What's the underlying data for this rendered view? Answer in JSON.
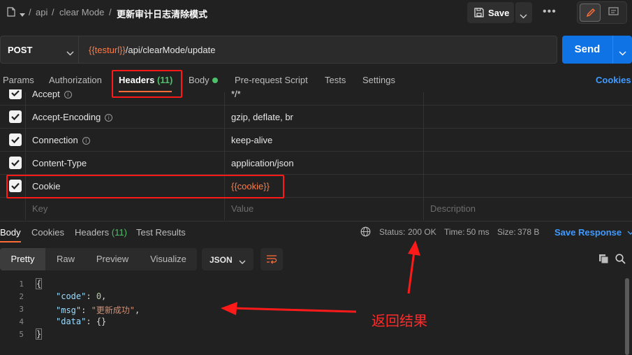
{
  "breadcrumb": {
    "parts": [
      "api",
      "clear Mode"
    ],
    "title": "更新审计日志清除模式",
    "separator": "/"
  },
  "toolbar": {
    "save_label": "Save",
    "more_label": "•••"
  },
  "request": {
    "method": "POST",
    "url_var": "{{testurl}}",
    "url_path": "/api/clearMode/update",
    "send_label": "Send"
  },
  "tabs": {
    "params": "Params",
    "authorization": "Authorization",
    "headers": "Headers",
    "headers_count": "(11)",
    "body": "Body",
    "prerequest": "Pre-request Script",
    "tests": "Tests",
    "settings": "Settings",
    "cookies": "Cookies"
  },
  "headers_table": {
    "rows": [
      {
        "key": "Accept",
        "value": "*/*",
        "info": true
      },
      {
        "key": "Accept-Encoding",
        "value": "gzip, deflate, br",
        "info": true
      },
      {
        "key": "Connection",
        "value": "keep-alive",
        "info": true
      },
      {
        "key": "Content-Type",
        "value": "application/json",
        "info": false
      },
      {
        "key": "Cookie",
        "value": "{{cookie}}",
        "info": false
      }
    ],
    "placeholder_key": "Key",
    "placeholder_value": "Value",
    "placeholder_description": "Description"
  },
  "response": {
    "tabs": {
      "body": "Body",
      "cookies": "Cookies",
      "headers": "Headers",
      "headers_count": "(11)",
      "test_results": "Test Results"
    },
    "status_label": "Status:",
    "status_value": "200 OK",
    "time_label": "Time:",
    "time_value": "50 ms",
    "size_label": "Size:",
    "size_value": "378 B",
    "save_response": "Save Response",
    "views": {
      "pretty": "Pretty",
      "raw": "Raw",
      "preview": "Preview",
      "visualize": "Visualize"
    },
    "format": "JSON",
    "code": {
      "line_numbers": [
        "1",
        "2",
        "3",
        "4",
        "5"
      ],
      "open": "{",
      "code_key": "\"code\"",
      "code_val": "0",
      "msg_key": "\"msg\"",
      "msg_val": "\"更新成功\"",
      "data_key": "\"data\"",
      "data_val": "{}",
      "close": "}"
    }
  },
  "annotation": {
    "text": "返回结果",
    "color": "#ff2a2a"
  },
  "colors": {
    "accent": "#ff6c37",
    "send": "#0f72e5",
    "link": "#3f9bff",
    "success": "#4fc06a",
    "highlight_box": "#ff1a1a"
  }
}
